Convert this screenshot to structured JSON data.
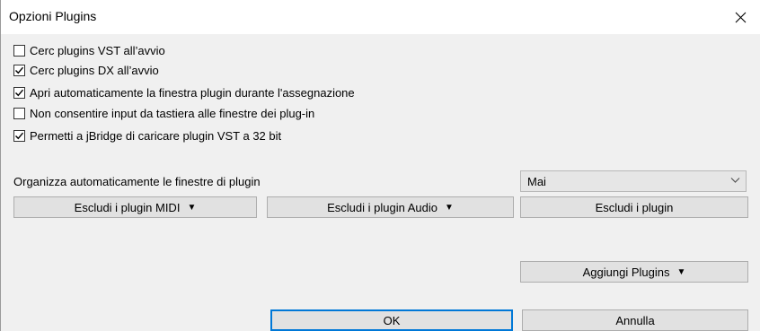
{
  "window": {
    "title": "Opzioni Plugins",
    "close_glyph": "✕"
  },
  "options": [
    {
      "label": "Cerc plugins VST all’avvio",
      "checked": false
    },
    {
      "label": "Cerc plugins DX all’avvio",
      "checked": true
    },
    {
      "label": "Apri automaticamente la finestra plugin durante l'assegnazione",
      "checked": true
    },
    {
      "label": "Non consentire input da tastiera alle finestre dei plug-in",
      "checked": false
    },
    {
      "label": "Permetti a jBridge di caricare plugin VST a 32 bit",
      "checked": true
    }
  ],
  "organize": {
    "label": "Organizza automaticamente le finestre di plugin",
    "selected": "Mai"
  },
  "buttons": {
    "exclude_midi": "Escludi i plugin MIDI",
    "exclude_audio": "Escludi i plugin Audio",
    "exclude_plugins": "Escludi i plugin",
    "add_plugins": "Aggiungi Plugins",
    "ok": "OK",
    "cancel": "Annulla",
    "dropdown_arrow": "▼"
  },
  "icons": {
    "close": "close-icon",
    "checkmark": "checkmark-icon",
    "chevron": "chevron-down-icon"
  }
}
